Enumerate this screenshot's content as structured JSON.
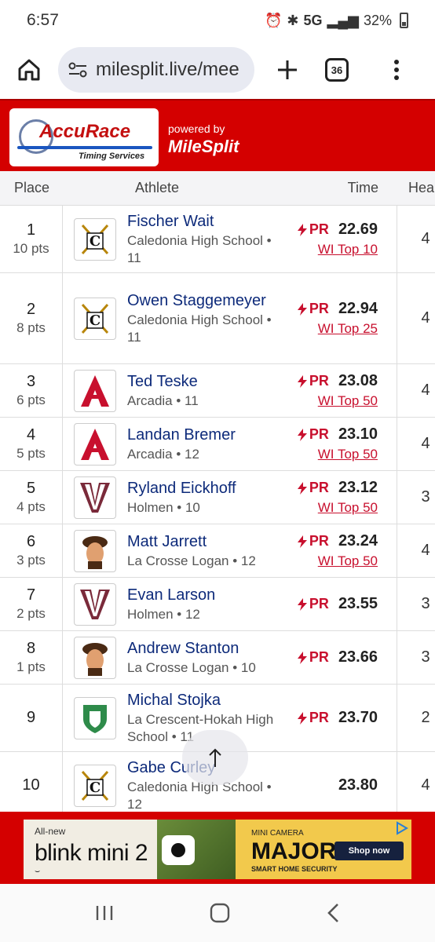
{
  "status": {
    "time": "6:57",
    "network": "5G",
    "battery": "32%"
  },
  "browser": {
    "url": "milesplit.live/mee",
    "tab_count": "36"
  },
  "banner": {
    "powered_by": "powered by",
    "brand": "MileSplit",
    "logo_text": "AccuRace",
    "logo_sub": "Timing Services"
  },
  "table": {
    "headers": {
      "place": "Place",
      "athlete": "Athlete",
      "time": "Time",
      "heat": "Hea"
    },
    "rows": [
      {
        "place": "1",
        "pts": "10 pts",
        "name": "Fischer Wait",
        "team": "Caledonia High School • 11",
        "pr": "PR",
        "time": "22.69",
        "top": "WI Top 10",
        "heat": "4"
      },
      {
        "place": "2",
        "pts": "8 pts",
        "name": "Owen Staggemeyer",
        "team": "Caledonia High School • 11",
        "pr": "PR",
        "time": "22.94",
        "top": "WI Top 25",
        "heat": "4"
      },
      {
        "place": "3",
        "pts": "6 pts",
        "name": "Ted Teske",
        "team": "Arcadia • 11",
        "pr": "PR",
        "time": "23.08",
        "top": "WI Top 50",
        "heat": "4"
      },
      {
        "place": "4",
        "pts": "5 pts",
        "name": "Landan Bremer",
        "team": "Arcadia • 12",
        "pr": "PR",
        "time": "23.10",
        "top": "WI Top 50",
        "heat": "4"
      },
      {
        "place": "5",
        "pts": "4 pts",
        "name": "Ryland Eickhoff",
        "team": "Holmen • 10",
        "pr": "PR",
        "time": "23.12",
        "top": "WI Top 50",
        "heat": "3"
      },
      {
        "place": "6",
        "pts": "3 pts",
        "name": "Matt Jarrett",
        "team": "La Crosse Logan • 12",
        "pr": "PR",
        "time": "23.24",
        "top": "WI Top 50",
        "heat": "4"
      },
      {
        "place": "7",
        "pts": "2 pts",
        "name": "Evan Larson",
        "team": "Holmen • 12",
        "pr": "PR",
        "time": "23.55",
        "top": "",
        "heat": "3"
      },
      {
        "place": "8",
        "pts": "1 pts",
        "name": "Andrew Stanton",
        "team": "La Crosse Logan • 10",
        "pr": "PR",
        "time": "23.66",
        "top": "",
        "heat": "3"
      },
      {
        "place": "9",
        "pts": "",
        "name": "Michal Stojka",
        "team": "La Crescent-Hokah High School • 11",
        "pr": "PR",
        "time": "23.70",
        "top": "",
        "heat": "2"
      },
      {
        "place": "10",
        "pts": "",
        "name": "Gabe Curley",
        "team": "Caledonia High School • 12",
        "pr": "",
        "time": "23.80",
        "top": "",
        "heat": "4"
      }
    ]
  },
  "ad": {
    "all_new": "All-new",
    "product": "blink mini 2",
    "mini_camera": "MINI CAMERA",
    "major": "MAJOR",
    "smart": "SMART HOME SECURITY",
    "shop": "Shop now"
  }
}
